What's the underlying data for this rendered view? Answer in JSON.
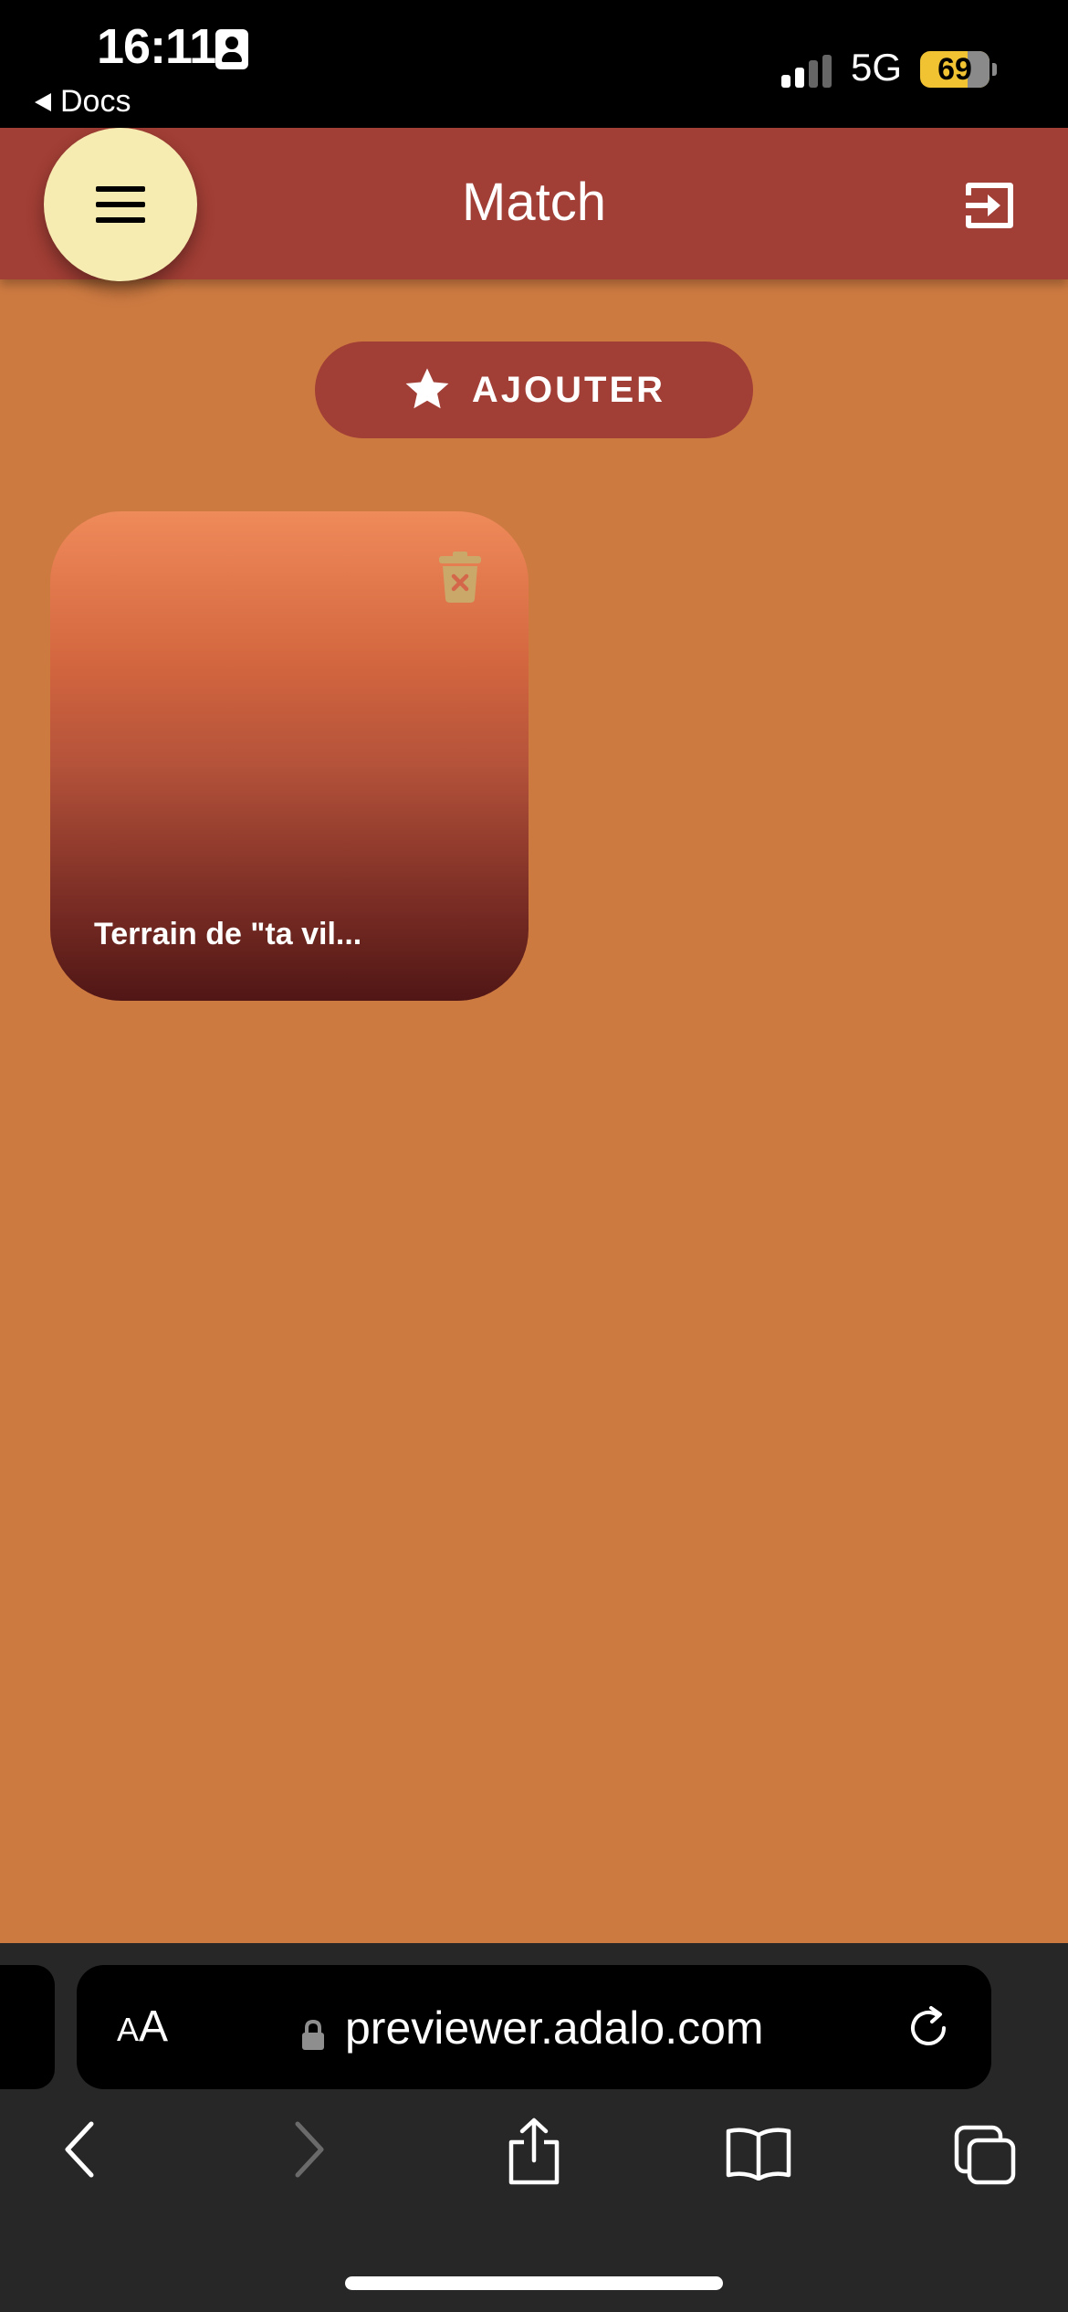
{
  "status_bar": {
    "time": "16:11",
    "back_app": "Docs",
    "network": "5G",
    "battery": "69"
  },
  "header": {
    "title": "Match"
  },
  "add_button": {
    "label": "AJOUTER"
  },
  "cards": [
    {
      "label": "Terrain de \"ta vil..."
    }
  ],
  "browser": {
    "text_size_label_small": "A",
    "text_size_label_large": "A",
    "url": "previewer.adalo.com"
  },
  "colors": {
    "background": "#cd7a41",
    "header": "#a13e35",
    "menu_fab": "#f6ebb1",
    "battery": "#f1c232"
  },
  "icons": {
    "menu": "hamburger-icon",
    "logout": "logout-icon",
    "add": "star-icon",
    "delete": "trash-icon",
    "lock": "lock-icon",
    "reload": "reload-icon",
    "back": "chevron-left-icon",
    "forward": "chevron-right-icon",
    "share": "share-icon",
    "bookmarks": "book-icon",
    "tabs": "tabs-icon"
  }
}
